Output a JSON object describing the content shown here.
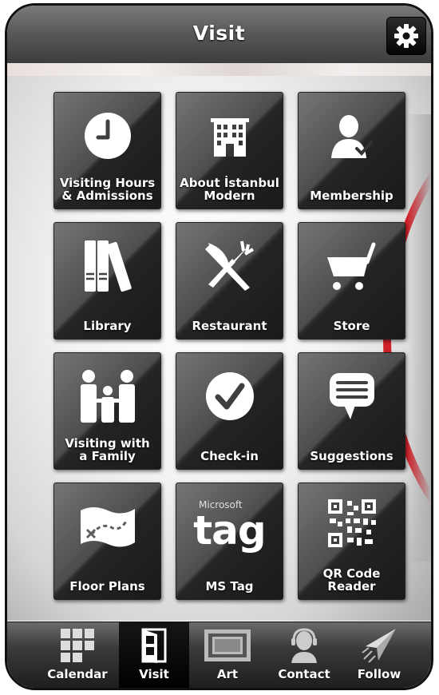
{
  "header": {
    "title": "Visit",
    "settings_icon": "gear-icon"
  },
  "tiles": [
    {
      "label": "Visiting Hours\n& Admissions",
      "icon": "clock-icon"
    },
    {
      "label": "About İstanbul\nModern",
      "icon": "building-icon"
    },
    {
      "label": "Membership",
      "icon": "member-icon"
    },
    {
      "label": "Library",
      "icon": "books-icon"
    },
    {
      "label": "Restaurant",
      "icon": "fork-knife-icon"
    },
    {
      "label": "Store",
      "icon": "cart-icon"
    },
    {
      "label": "Visiting with\na Family",
      "icon": "family-icon"
    },
    {
      "label": "Check-in",
      "icon": "checkmark-icon"
    },
    {
      "label": "Suggestions",
      "icon": "speech-bubble-icon"
    },
    {
      "label": "Floor Plans",
      "icon": "map-icon"
    },
    {
      "label": "MS Tag",
      "icon": "ms-tag-icon",
      "logo_text": "Microsoft",
      "logo_word": "tag"
    },
    {
      "label": "QR Code\nReader",
      "icon": "qr-code-icon"
    }
  ],
  "tabbar": {
    "active": "Visit",
    "items": [
      {
        "label": "Calendar",
        "icon": "calendar-grid-icon"
      },
      {
        "label": "Visit",
        "icon": "door-icon"
      },
      {
        "label": "Art",
        "icon": "frame-icon"
      },
      {
        "label": "Contact",
        "icon": "headset-icon"
      },
      {
        "label": "Follow",
        "icon": "paper-plane-icon"
      }
    ]
  },
  "colors": {
    "accent": "#d0202a",
    "tile": "#2a2a2a",
    "header": "#5a5a5a"
  }
}
